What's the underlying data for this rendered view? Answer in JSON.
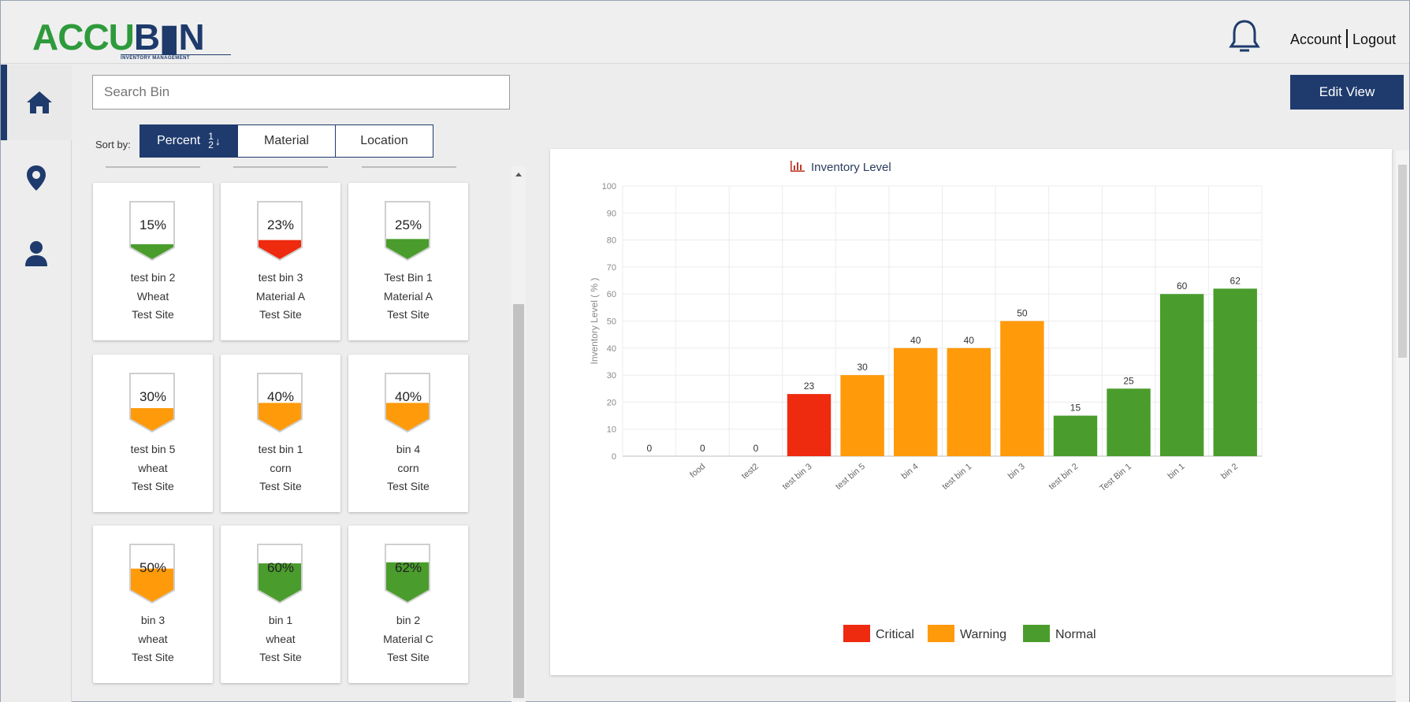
{
  "header": {
    "logo_text_green_1": "ACCU",
    "logo_text_blue": "B",
    "logo_text_green_2": "N",
    "logo_subtitle": "INVENTORY MANAGEMENT",
    "account_label": "Account",
    "logout_label": "Logout",
    "icons": {
      "notification": "bell-icon"
    }
  },
  "sidenav": {
    "items": [
      {
        "id": "home",
        "icon": "home-icon",
        "active": true
      },
      {
        "id": "location",
        "icon": "map-pin-icon",
        "active": false
      },
      {
        "id": "user",
        "icon": "user-icon",
        "active": false
      }
    ]
  },
  "search": {
    "placeholder": "Search Bin",
    "value": ""
  },
  "sort": {
    "label": "Sort by:",
    "options": [
      "Percent",
      "Material",
      "Location"
    ],
    "active": "Percent",
    "percent_icon_top": "1",
    "percent_icon_bottom": "2",
    "percent_icon_arrow": "↓"
  },
  "toolbar": {
    "edit_view_label": "Edit View"
  },
  "colors": {
    "critical": "#ee2a0f",
    "warning": "#ff9a0a",
    "normal": "#4a9d2c",
    "navy": "#1f3b6d"
  },
  "bins": [
    {
      "percent_label": "15%",
      "level": 15,
      "status": "normal",
      "name": "test bin 2",
      "material": "Wheat",
      "location": "Test Site"
    },
    {
      "percent_label": "23%",
      "level": 23,
      "status": "critical",
      "name": "test bin 3",
      "material": "Material A",
      "location": "Test Site"
    },
    {
      "percent_label": "25%",
      "level": 25,
      "status": "normal",
      "name": "Test Bin 1",
      "material": "Material A",
      "location": "Test Site"
    },
    {
      "percent_label": "30%",
      "level": 30,
      "status": "warning",
      "name": "test bin 5",
      "material": "wheat",
      "location": "Test Site"
    },
    {
      "percent_label": "40%",
      "level": 40,
      "status": "warning",
      "name": "test bin 1",
      "material": "corn",
      "location": "Test Site"
    },
    {
      "percent_label": "40%",
      "level": 40,
      "status": "warning",
      "name": "bin 4",
      "material": "corn",
      "location": "Test Site"
    },
    {
      "percent_label": "50%",
      "level": 50,
      "status": "warning",
      "name": "bin 3",
      "material": "wheat",
      "location": "Test Site"
    },
    {
      "percent_label": "60%",
      "level": 60,
      "status": "normal",
      "name": "bin 1",
      "material": "wheat",
      "location": "Test Site"
    },
    {
      "percent_label": "62%",
      "level": 62,
      "status": "normal",
      "name": "bin 2",
      "material": "Material C",
      "location": "Test Site"
    }
  ],
  "chart_data": {
    "type": "bar",
    "title": "Inventory Level",
    "title_icon": "bar-chart-icon",
    "ylabel": "Inventory Level ( % )",
    "xlabel": "",
    "ylim": [
      0,
      100
    ],
    "yticks": [
      0,
      10,
      20,
      30,
      40,
      50,
      60,
      70,
      80,
      90,
      100
    ],
    "grid": true,
    "categories": [
      "",
      "food",
      "test2",
      "test bin 3",
      "test bin 5",
      "bin 4",
      "test bin 1",
      "bin 3",
      "test bin 2",
      "Test Bin 1",
      "bin 1",
      "bin 2"
    ],
    "values": [
      0,
      0,
      0,
      23,
      30,
      40,
      40,
      50,
      15,
      25,
      60,
      62
    ],
    "status": [
      "normal",
      "normal",
      "normal",
      "critical",
      "warning",
      "warning",
      "warning",
      "warning",
      "normal",
      "normal",
      "normal",
      "normal"
    ],
    "legend_position": "bottom",
    "legend": [
      {
        "name": "Critical",
        "status": "critical"
      },
      {
        "name": "Warning",
        "status": "warning"
      },
      {
        "name": "Normal",
        "status": "normal"
      }
    ]
  }
}
